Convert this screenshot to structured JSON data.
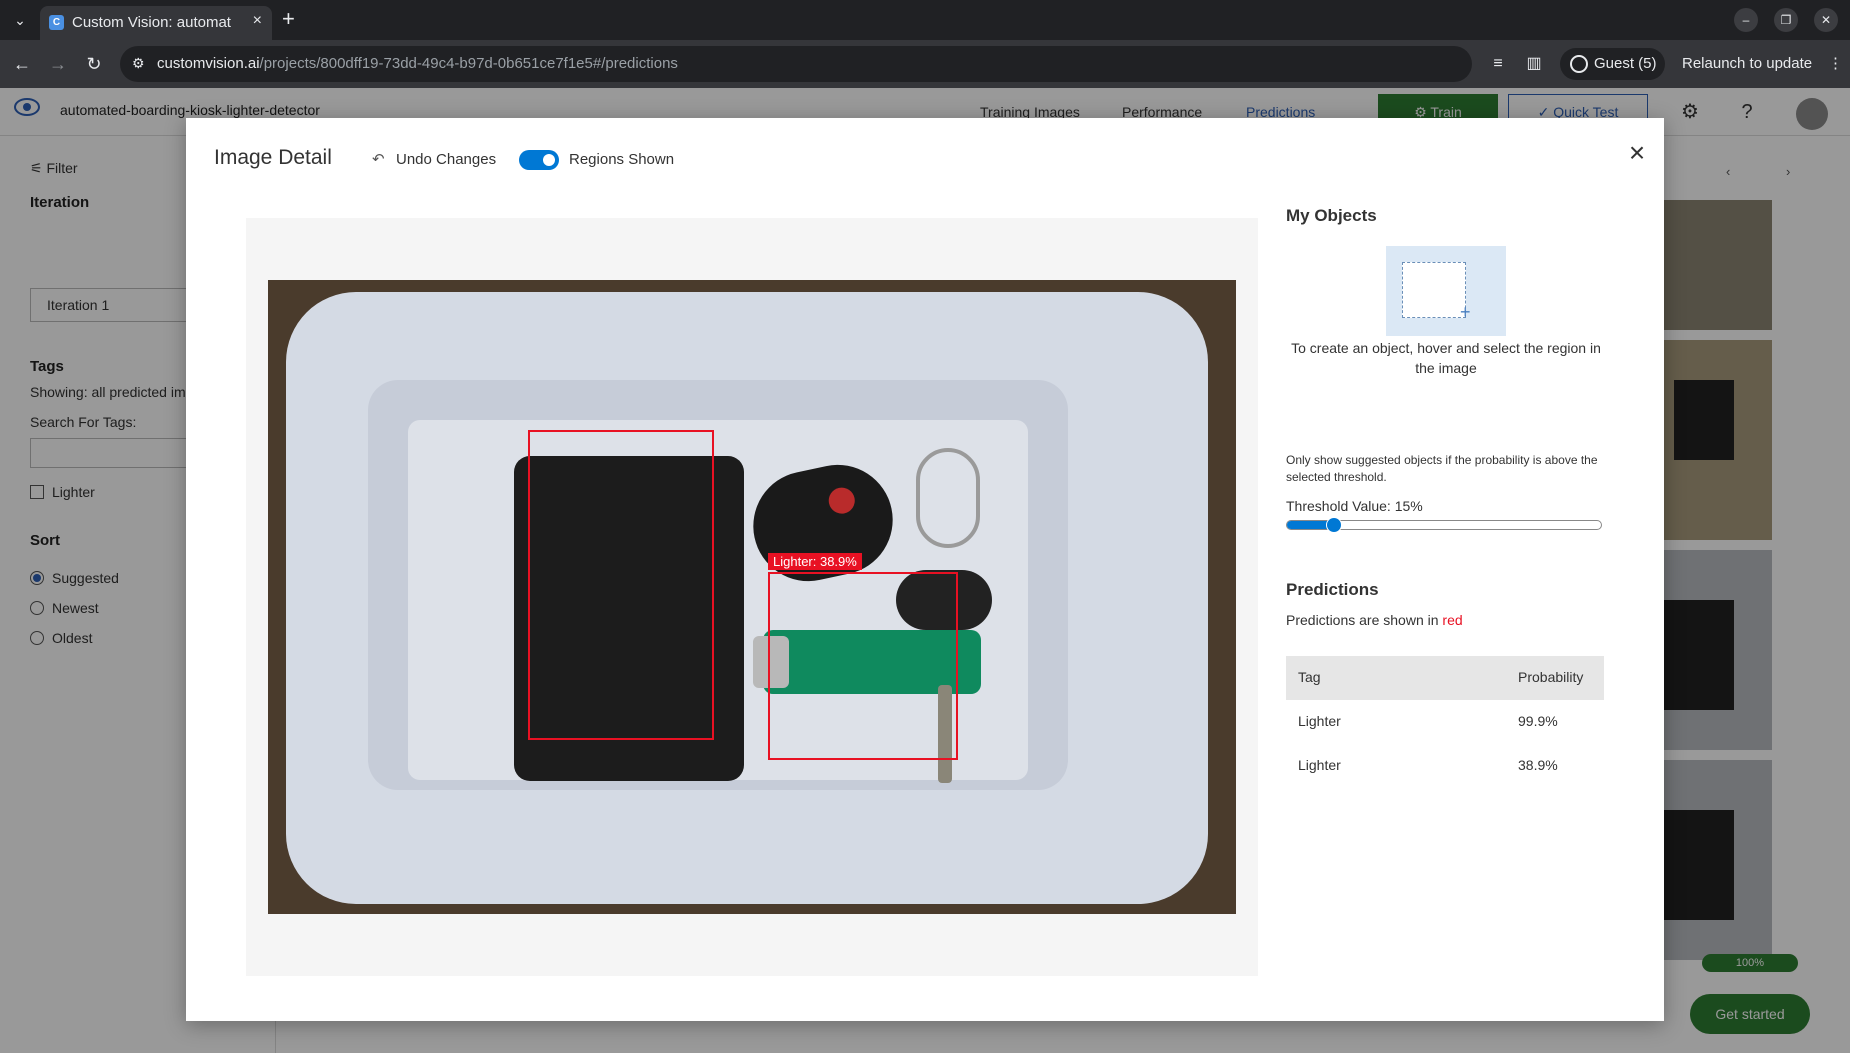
{
  "browser": {
    "tab_title": "Custom Vision: automat",
    "url_host": "customvision.ai",
    "url_path": "/projects/800dff19-73dd-49c4-b97d-0b651ce7f1e5#/predictions",
    "guest_label": "Guest (5)",
    "relaunch_label": "Relaunch to update"
  },
  "app": {
    "project_name": "automated-boarding-kiosk-lighter-detector",
    "nav": {
      "training_images": "Training Images",
      "performance": "Performance",
      "predictions": "Predictions"
    },
    "train_label": "Train",
    "quick_test_label": "Quick Test",
    "sidebar": {
      "filter_label": "Filter",
      "iteration_heading": "Iteration",
      "iteration_value": "Iteration 1",
      "tags_heading": "Tags",
      "showing_text": "Showing: all predicted im",
      "search_label": "Search For Tags:",
      "tag_item": "Lighter",
      "sort_heading": "Sort",
      "sort_options": [
        "Suggested",
        "Newest",
        "Oldest"
      ]
    },
    "progress_label": "100%",
    "get_started_label": "Get started"
  },
  "modal": {
    "title": "Image Detail",
    "undo_label": "Undo Changes",
    "regions_label": "Regions Shown",
    "regions_on": true,
    "box_label": "Lighter: 38.9%",
    "my_objects_heading": "My Objects",
    "create_note": "To create an object, hover and select the region in the image",
    "threshold_note": "Only show suggested objects if the probability is above the selected threshold.",
    "threshold_label": "Threshold Value: 15%",
    "threshold_value": 0.15,
    "predictions_heading": "Predictions",
    "predictions_note_prefix": "Predictions are shown in",
    "predictions_note_color": "red",
    "table": {
      "headers": [
        "Tag",
        "Probability"
      ],
      "rows": [
        {
          "tag": "Lighter",
          "probability": "99.9%"
        },
        {
          "tag": "Lighter",
          "probability": "38.9%"
        }
      ]
    },
    "accent": "#0078d4",
    "box_color": "#e81123"
  }
}
